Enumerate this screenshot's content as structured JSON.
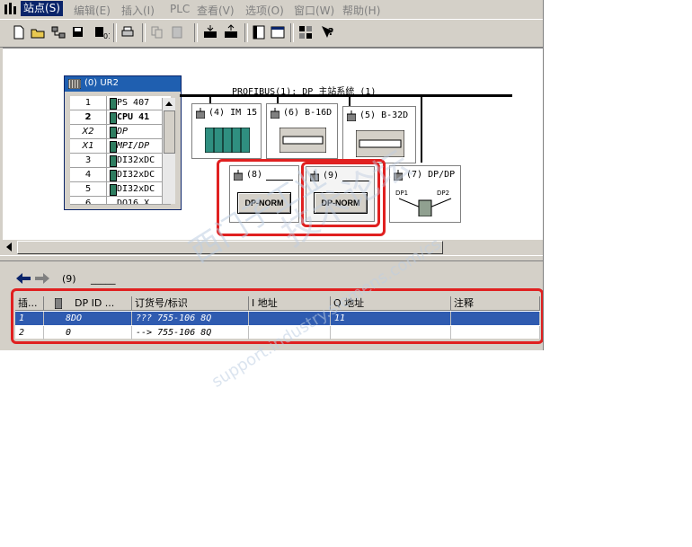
{
  "menubar": {
    "items": [
      "站点(S)",
      "编辑(E)",
      "插入(I)",
      "PLC",
      "查看(V)",
      "选项(O)",
      "窗口(W)",
      "帮助(H)"
    ]
  },
  "toolbar": {
    "buttons": [
      "new-icon",
      "open-icon",
      "network-icon",
      "save-icon",
      "compile-icon",
      "print-icon",
      "copy-icon",
      "paste-icon",
      "download-icon",
      "upload-icon",
      "catalog-icon",
      "window-icon",
      "hardware-catalog-icon",
      "help-icon"
    ]
  },
  "rack": {
    "title": "(0) UR2",
    "rows": [
      {
        "slot": "1",
        "module": "PS 407"
      },
      {
        "slot": "2",
        "module": "CPU 41"
      },
      {
        "slot": "X2",
        "module": "DP"
      },
      {
        "slot": "X1",
        "module": "MPI/DP"
      },
      {
        "slot": "3",
        "module": "DI32xDC"
      },
      {
        "slot": "4",
        "module": "DI32xDC"
      },
      {
        "slot": "5",
        "module": "DI32xDC"
      },
      {
        "slot": "6",
        "module": "DO16 X"
      }
    ]
  },
  "bus": {
    "label": "PROFIBUS(1): DP 主站系统 (1)"
  },
  "stations": {
    "s4": "(4) IM 15",
    "s6": "(6) B-16D",
    "s5": "(5) B-32D",
    "s8": "(8)",
    "s9": "(9)",
    "s7": "(7) DP/DP",
    "dpnorm": "DP-NORM",
    "dp1": "DP1",
    "dp2": "DP2"
  },
  "lower": {
    "nav_label": "(9)",
    "nav_name": "_____",
    "headers": [
      "插...",
      "DP ID ...",
      "订货号/标识",
      "I 地址",
      "Q 地址",
      "注释"
    ],
    "rows": [
      {
        "slot": "1",
        "dpid": "8DO",
        "order": "??? 755-106  8Q",
        "i_addr": "",
        "q_addr": "11",
        "comment": ""
      },
      {
        "slot": "2",
        "dpid": "0",
        "order": "--> 755-106  8Q",
        "i_addr": "",
        "q_addr": "",
        "comment": ""
      }
    ]
  },
  "watermark": {
    "line1": "西门子工业",
    "line2": "support.industry.siemens.com/cs",
    "line3": "技术论坛"
  },
  "colors": {
    "selection": "#2f5bb0",
    "highlight": "#e02020",
    "menu_active": "#0a246a"
  }
}
